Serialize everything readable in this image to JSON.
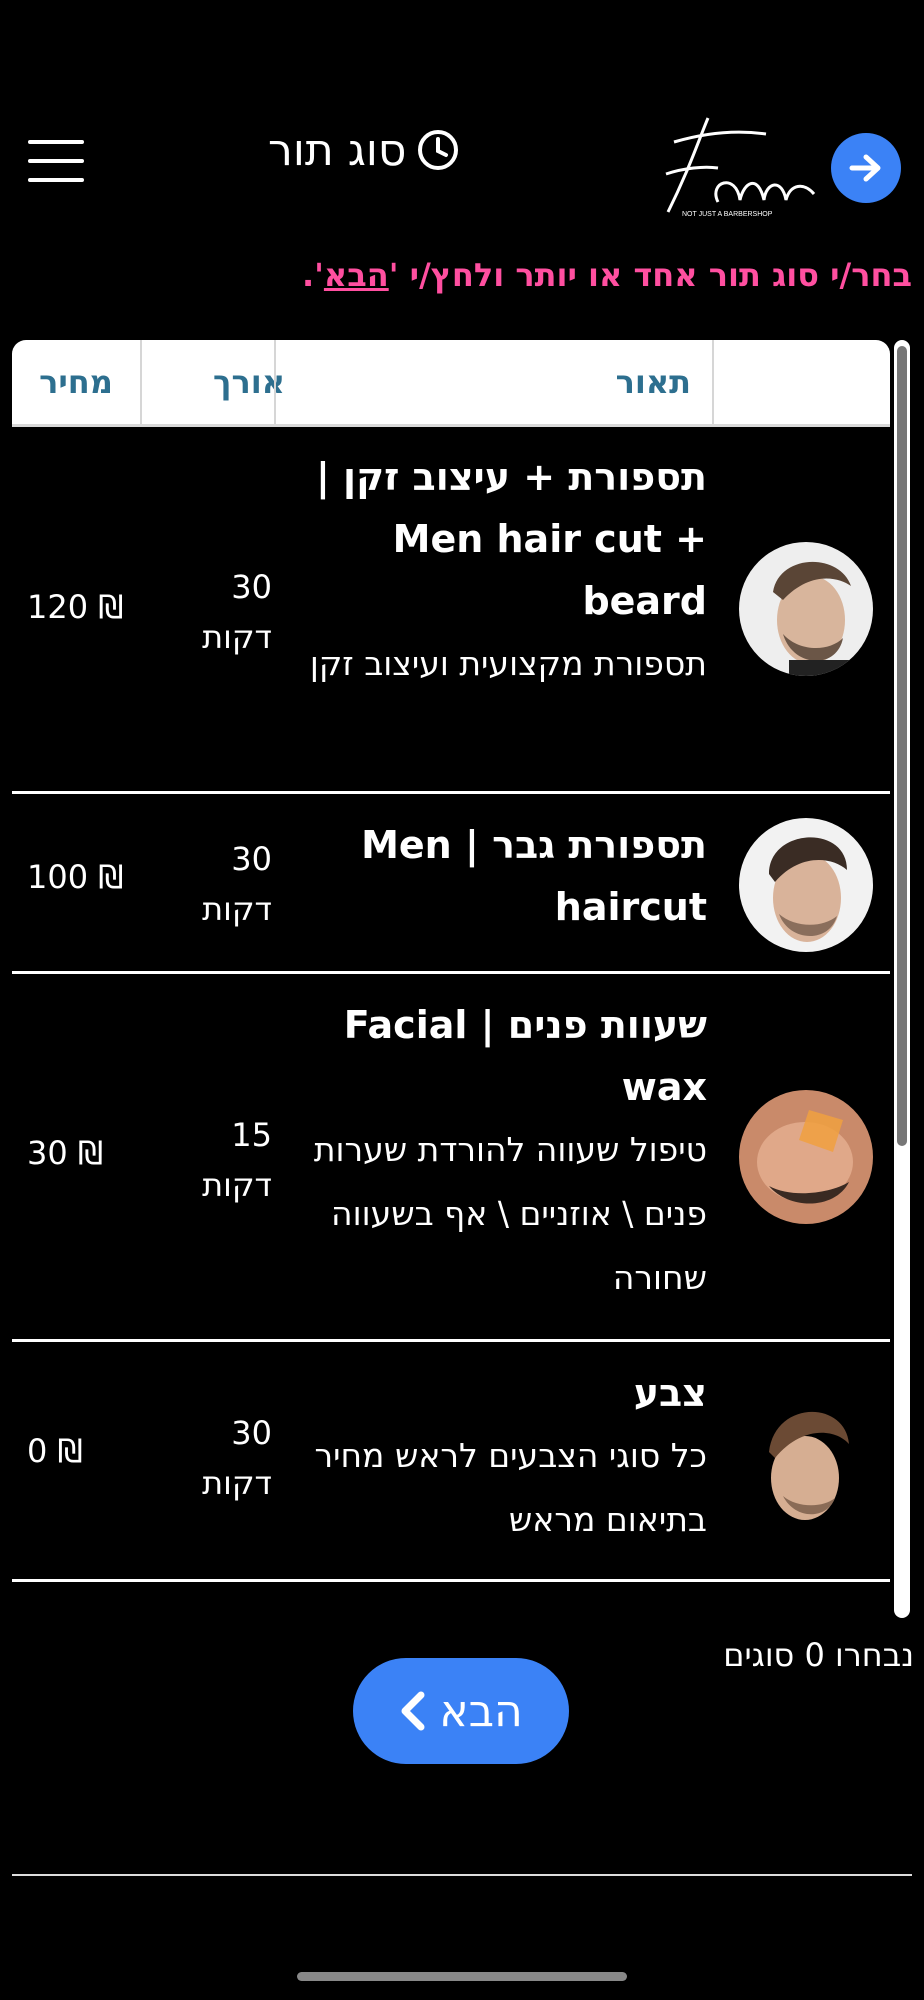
{
  "header": {
    "title": "סוג תור",
    "logo_text": "Fam",
    "logo_tagline": "NOT JUST A BARBERSHOP",
    "icons": {
      "menu": "hamburger-menu-icon",
      "clock": "clock-icon",
      "next": "arrow-right-icon"
    }
  },
  "instruction": {
    "before": "בחר/י סוג תור אחד או יותר ולחץ/י '",
    "link": "הבא",
    "after": "'."
  },
  "table": {
    "headers": {
      "description": "תאור",
      "duration": "אורך",
      "price": "מחיר"
    },
    "rows": [
      {
        "name": "תספורת + עיצוב זקן | Men hair cut + beard",
        "description": "תספורת מקצועית ועיצוב זקן",
        "duration": "30",
        "duration_unit": "דקות",
        "price": "120 ₪"
      },
      {
        "name": "תספורת גבר | Men haircut",
        "description": "",
        "duration": "30",
        "duration_unit": "דקות",
        "price": "100 ₪"
      },
      {
        "name": "שעוות פנים | Facial wax",
        "description": "טיפול שעווה להורדת שערות פנים \\ אוזניים \\ אף בשעווה שחורה",
        "duration": "15",
        "duration_unit": "דקות",
        "price": "30 ₪"
      },
      {
        "name": "צבע",
        "description": "כל סוגי הצבעים לראש מחיר בתיאום מראש",
        "duration": "30",
        "duration_unit": "דקות",
        "price": "0 ₪"
      }
    ]
  },
  "selection": {
    "count_text": "נבחרו 0 סוגים"
  },
  "next_button": {
    "label": "הבא",
    "icon": "chevron-left-icon"
  },
  "colors": {
    "background": "#000000",
    "accent": "#3b82f6",
    "instruction": "#ff4fa0",
    "header_text": "#2d6f8f"
  }
}
